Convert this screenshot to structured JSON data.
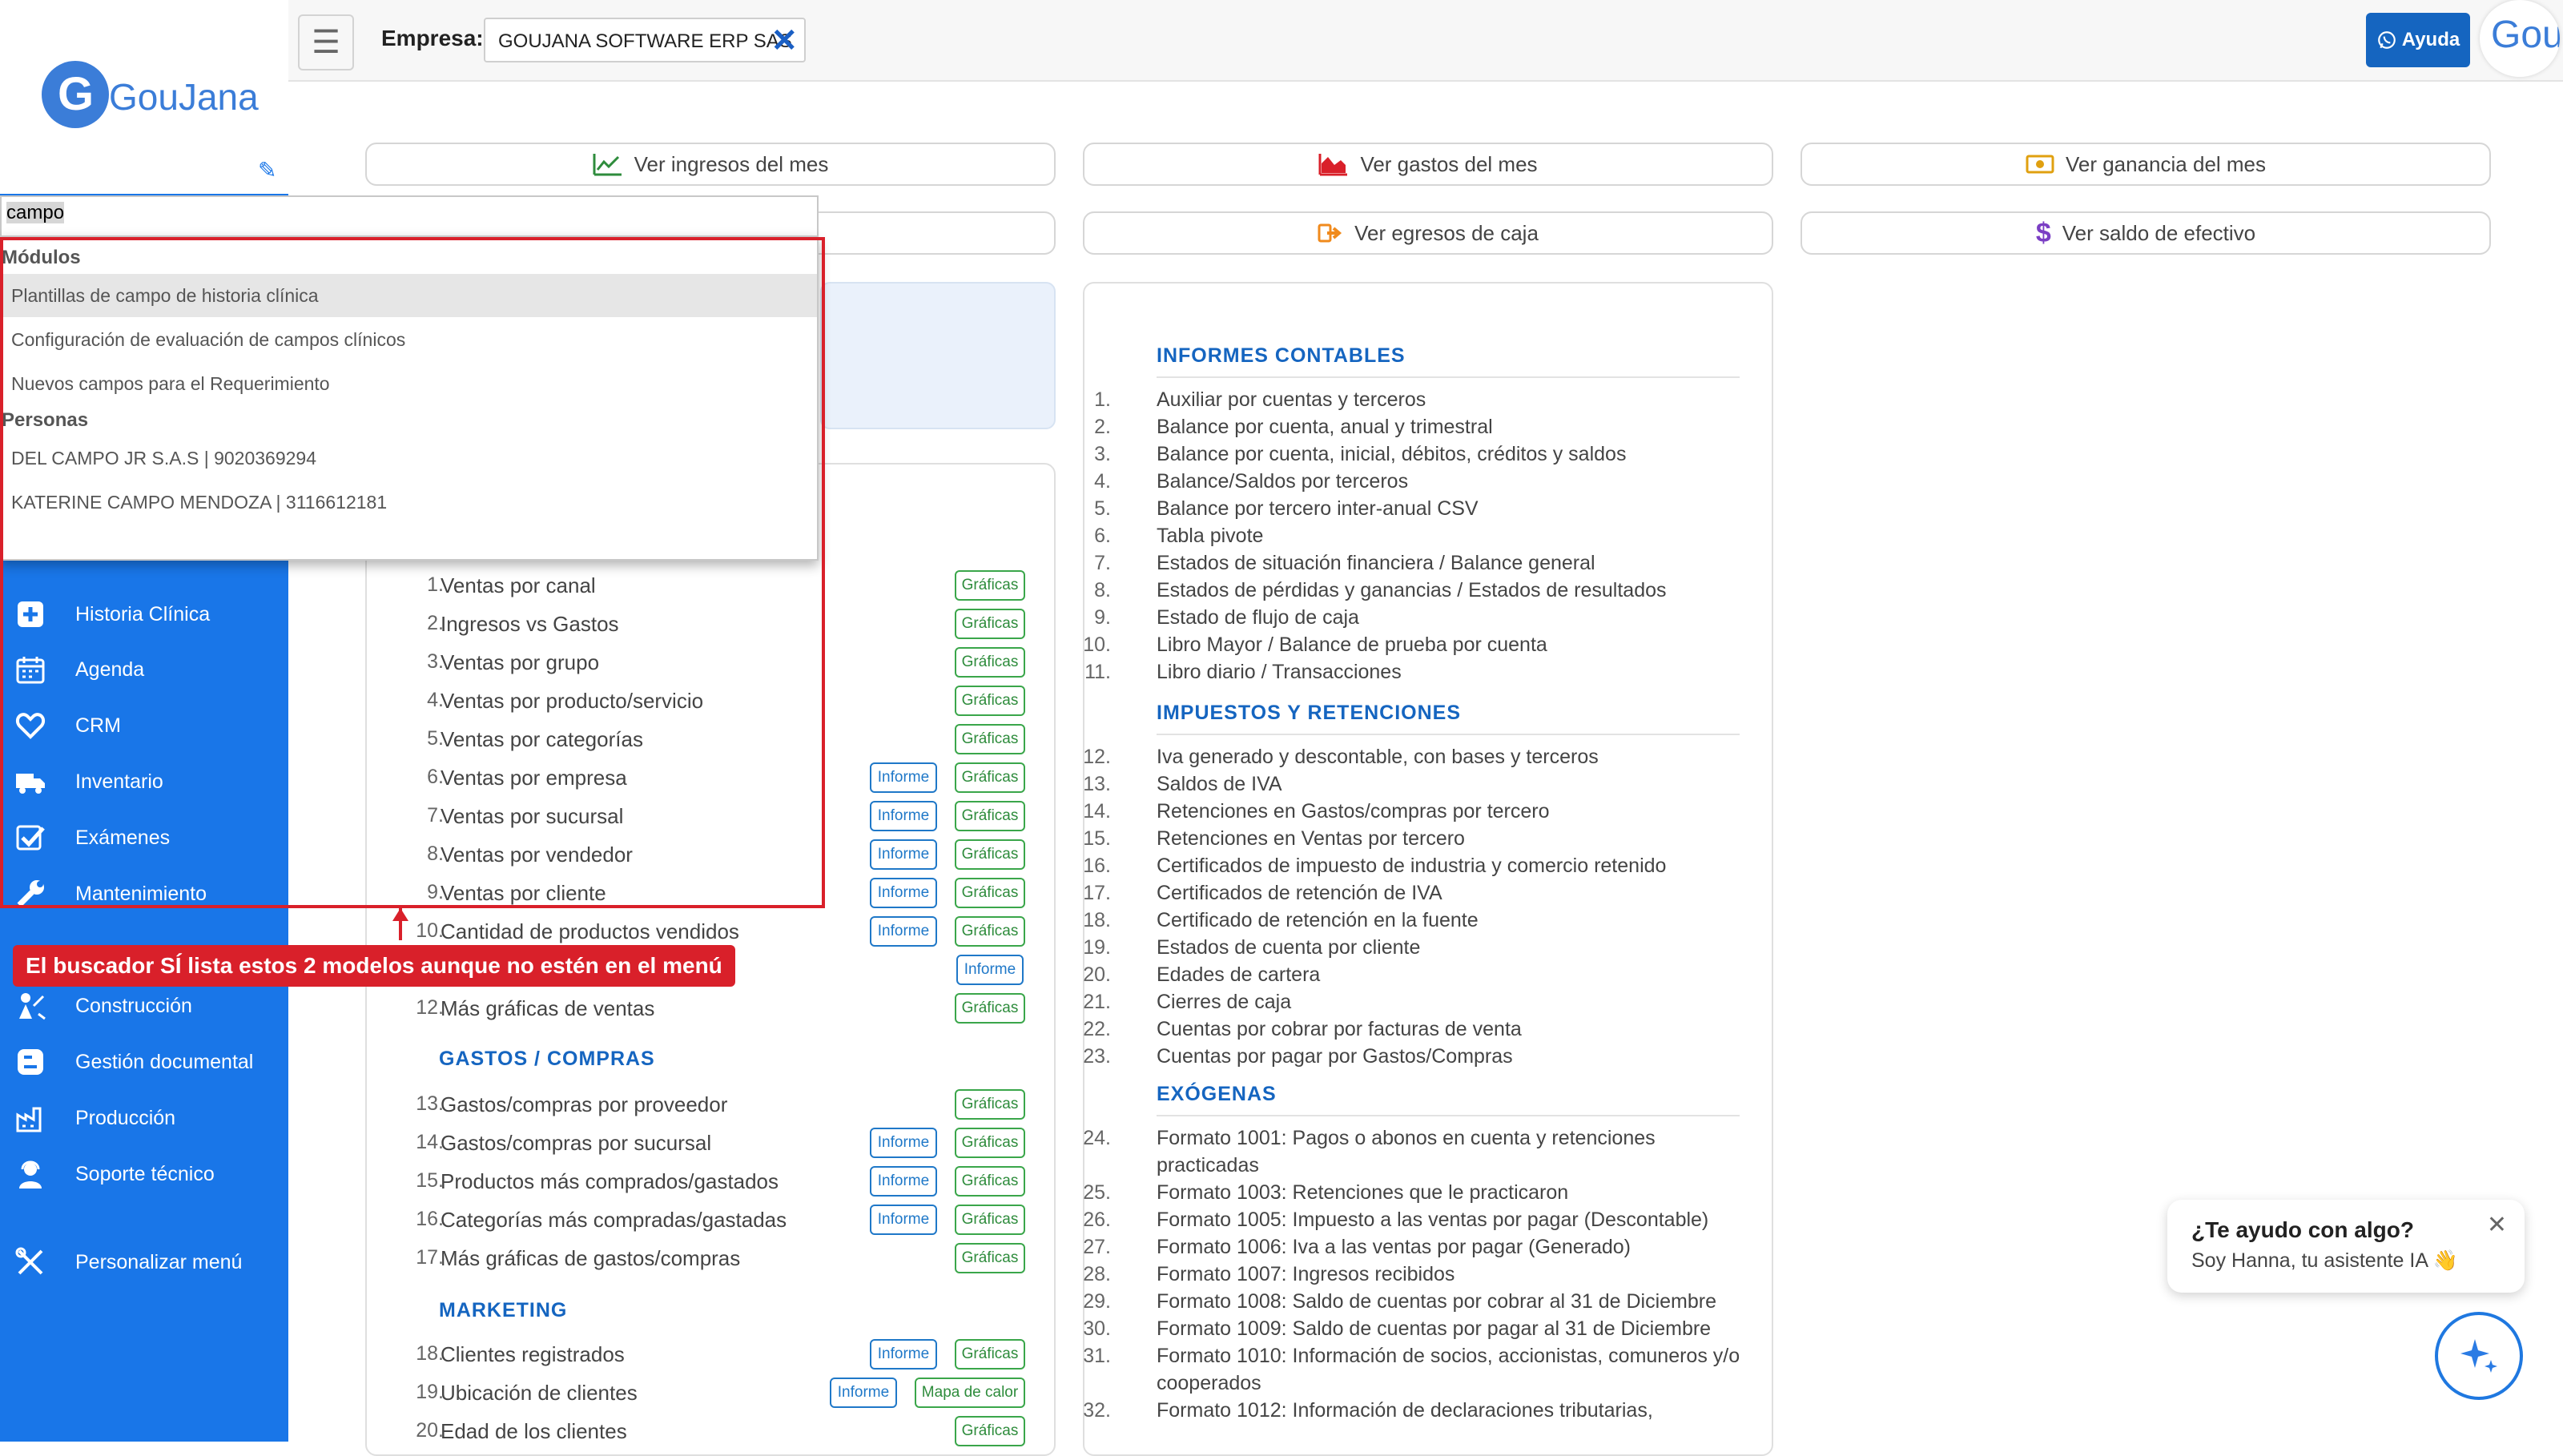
{
  "topbar": {
    "empresa_label": "Empresa:",
    "empresa_value": "GOUJANA SOFTWARE ERP SAS",
    "help_label": "Ayuda",
    "avatar_text": "Gou"
  },
  "logo": {
    "mark": "G",
    "text": "GouJana"
  },
  "search": {
    "value": "campo",
    "sections": [
      {
        "heading": "Módulos",
        "items": [
          "Plantillas de campo de historia clínica",
          "Configuración de evaluación de campos clínicos",
          "Nuevos campos para el Requerimiento"
        ]
      },
      {
        "heading": "Personas",
        "items": [
          "DEL CAMPO JR S.A.S | 9020369294",
          "KATERINE CAMPO MENDOZA | 3116612181"
        ]
      }
    ]
  },
  "annotation": {
    "text": "El buscador SÍ lista estos 2 modelos aunque no estén en el menú"
  },
  "sidebar": {
    "items": [
      {
        "label": "Historia Clínica",
        "icon": "plus-box-icon"
      },
      {
        "label": "Agenda",
        "icon": "calendar-icon"
      },
      {
        "label": "CRM",
        "icon": "heart-icon"
      },
      {
        "label": "Inventario",
        "icon": "truck-icon"
      },
      {
        "label": "Exámenes",
        "icon": "checkbox-icon"
      },
      {
        "label": "Mantenimiento",
        "icon": "wrench-icon"
      },
      {
        "label": "Construcción",
        "icon": "construction-icon"
      },
      {
        "label": "Gestión documental",
        "icon": "blogger-icon"
      },
      {
        "label": "Producción",
        "icon": "factory-icon"
      },
      {
        "label": "Soporte técnico",
        "icon": "support-agent-icon"
      },
      {
        "label": "Personalizar menú",
        "icon": "tools-icon"
      }
    ]
  },
  "quick": {
    "ingresos": "Ver ingresos del mes",
    "gastos": "Ver gastos del mes",
    "ganancia": "Ver ganancia del mes",
    "egresos": "Ver egresos de caja",
    "saldo": "Ver saldo de efectivo"
  },
  "tags": {
    "grafica": "Gráficas",
    "informe": "Informe",
    "heat": "Mapa de calor"
  },
  "reports": {
    "ventas": [
      {
        "n": "1.",
        "label": "Ventas por canal",
        "inf": false
      },
      {
        "n": "2.",
        "label": "Ingresos vs Gastos",
        "inf": false
      },
      {
        "n": "3.",
        "label": "Ventas por grupo",
        "inf": false
      },
      {
        "n": "4.",
        "label": "Ventas por producto/servicio",
        "inf": false
      },
      {
        "n": "5.",
        "label": "Ventas por categorías",
        "inf": false
      },
      {
        "n": "6.",
        "label": "Ventas por empresa",
        "inf": true
      },
      {
        "n": "7.",
        "label": "Ventas por sucursal",
        "inf": true
      },
      {
        "n": "8.",
        "label": "Ventas por vendedor",
        "inf": true
      },
      {
        "n": "9.",
        "label": "Ventas por cliente",
        "inf": true
      },
      {
        "n": "10.",
        "label": "Cantidad de productos vendidos",
        "inf": true
      },
      {
        "n": "",
        "label": "",
        "inf": "only"
      },
      {
        "n": "12.",
        "label": "Más gráficas de ventas",
        "inf": false
      }
    ],
    "gastos_title": "GASTOS / COMPRAS",
    "gastos": [
      {
        "n": "13.",
        "label": "Gastos/compras por proveedor",
        "inf": false
      },
      {
        "n": "14.",
        "label": "Gastos/compras por sucursal",
        "inf": true
      },
      {
        "n": "15.",
        "label": "Productos más comprados/gastados",
        "inf": true
      },
      {
        "n": "16.",
        "label": "Categorías más compradas/gastadas",
        "inf": true
      },
      {
        "n": "17.",
        "label": "Más gráficas de gastos/compras",
        "inf": false
      }
    ],
    "marketing_title": "MARKETING",
    "marketing": [
      {
        "n": "18.",
        "label": "Clientes registrados",
        "inf": true
      },
      {
        "n": "19.",
        "label": "Ubicación de clientes",
        "inf": "heat"
      },
      {
        "n": "20.",
        "label": "Edad de los clientes",
        "inf": false
      }
    ]
  },
  "accounting": {
    "sections": [
      {
        "title": "INFORMES CONTABLES",
        "items": [
          [
            "1.",
            "Auxiliar por cuentas y terceros"
          ],
          [
            "2.",
            "Balance por cuenta, anual y trimestral"
          ],
          [
            "3.",
            "Balance por cuenta, inicial, débitos, créditos y saldos"
          ],
          [
            "4.",
            "Balance/Saldos por terceros"
          ],
          [
            "5.",
            "Balance por tercero inter-anual CSV"
          ],
          [
            "6.",
            "Tabla pivote"
          ],
          [
            "7.",
            "Estados de situación financiera / Balance general"
          ],
          [
            "8.",
            "Estados de pérdidas y ganancias / Estados de resultados"
          ],
          [
            "9.",
            "Estado de flujo de caja"
          ],
          [
            "10.",
            "Libro Mayor / Balance de prueba por cuenta"
          ],
          [
            "11.",
            "Libro diario / Transacciones"
          ]
        ]
      },
      {
        "title": "IMPUESTOS Y RETENCIONES",
        "items": [
          [
            "12.",
            "Iva generado y descontable, con bases y terceros"
          ],
          [
            "13.",
            "Saldos de IVA"
          ],
          [
            "14.",
            "Retenciones en Gastos/compras por tercero"
          ],
          [
            "15.",
            "Retenciones en Ventas por tercero"
          ],
          [
            "16.",
            "Certificados de impuesto de industria y comercio retenido"
          ],
          [
            "17.",
            "Certificados de retención de IVA"
          ],
          [
            "18.",
            "Certificado de retención en la fuente"
          ],
          [
            "19.",
            "Estados de cuenta por cliente"
          ],
          [
            "20.",
            "Edades de cartera"
          ],
          [
            "21.",
            "Cierres de caja"
          ],
          [
            "22.",
            "Cuentas por cobrar por facturas de venta"
          ],
          [
            "23.",
            "Cuentas por pagar por Gastos/Compras"
          ]
        ]
      },
      {
        "title": "EXÓGENAS",
        "items": [
          [
            "24.",
            "Formato 1001: Pagos o abonos en cuenta y retenciones practicadas"
          ],
          [
            "25.",
            "Formato 1003: Retenciones que le practicaron"
          ],
          [
            "26.",
            "Formato 1005: Impuesto a las ventas por pagar (Descontable)"
          ],
          [
            "27.",
            "Formato 1006: Iva a las ventas por pagar (Generado)"
          ],
          [
            "28.",
            "Formato 1007: Ingresos recibidos"
          ],
          [
            "29.",
            "Formato 1008: Saldo de cuentas por cobrar al 31 de Diciembre"
          ],
          [
            "30.",
            "Formato 1009: Saldo de cuentas por pagar al 31 de Diciembre"
          ],
          [
            "31.",
            "Formato 1010: Información de socios, accionistas, comuneros y/o cooperados"
          ],
          [
            "32.",
            "Formato 1012: Información de declaraciones tributarias,"
          ]
        ]
      }
    ]
  },
  "chat": {
    "title": "¿Te ayudo con algo?",
    "subtitle": "Soy Hanna, tu asistente IA 👋"
  }
}
